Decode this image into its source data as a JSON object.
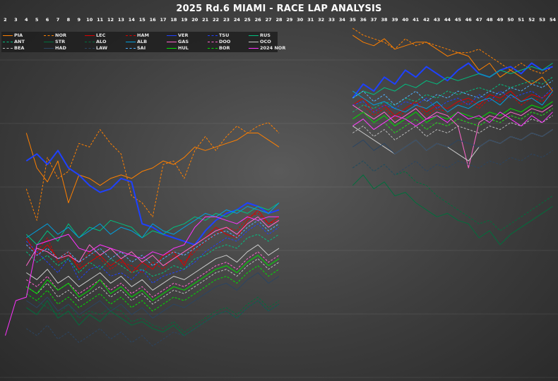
{
  "chart_data": {
    "type": "line",
    "title": "2025 Rd.6 MIAMI - RACE LAP ANALYSIS",
    "x": [
      2,
      3,
      4,
      5,
      6,
      7,
      8,
      9,
      10,
      11,
      12,
      13,
      14,
      15,
      16,
      17,
      18,
      19,
      20,
      21,
      22,
      23,
      24,
      25,
      26,
      27,
      28,
      29,
      30,
      31,
      32,
      33,
      34,
      35,
      36,
      37,
      38,
      39,
      40,
      41,
      42,
      43,
      44,
      45,
      46,
      47,
      48,
      49,
      50,
      51,
      52,
      53,
      54
    ],
    "xlim": [
      1.5,
      54.5
    ],
    "ylim": [
      0,
      100
    ],
    "grid": true,
    "legend_position": "top-left",
    "series": [
      {
        "name": "PIA",
        "color": "#ff8000",
        "dash": "solid",
        "values": [
          null,
          null,
          70,
          60,
          56,
          62,
          50,
          58,
          57,
          55,
          57,
          58,
          57,
          59,
          60,
          62,
          61,
          63,
          66,
          65,
          66,
          67,
          68,
          70,
          70,
          68,
          66,
          null,
          null,
          null,
          null,
          null,
          null,
          98,
          96,
          95,
          97,
          94,
          95,
          96,
          96,
          94,
          92,
          93,
          92,
          88,
          90,
          86,
          88,
          86,
          84,
          86,
          82
        ]
      },
      {
        "name": "NOR",
        "color": "#ff8000",
        "dash": "dashed",
        "values": [
          null,
          null,
          54,
          45,
          63,
          57,
          59,
          67,
          66,
          71,
          67,
          64,
          52,
          50,
          46,
          61,
          62,
          57,
          65,
          69,
          65,
          69,
          72,
          70,
          72,
          73,
          70,
          null,
          null,
          null,
          null,
          null,
          null,
          100,
          98,
          97,
          96,
          94,
          97,
          95,
          96,
          95,
          94,
          93,
          93,
          94,
          92,
          90,
          88,
          90,
          88,
          87,
          89
        ]
      },
      {
        "name": "LEC",
        "color": "#dc0000",
        "dash": "solid",
        "values": [
          null,
          null,
          40,
          35,
          38,
          34,
          36,
          31,
          33,
          35,
          32,
          34,
          30,
          33,
          31,
          35,
          36,
          32,
          38,
          40,
          43,
          41,
          40,
          45,
          48,
          44,
          46,
          null,
          null,
          null,
          null,
          null,
          null,
          78,
          80,
          76,
          78,
          75,
          77,
          79,
          76,
          78,
          77,
          79,
          80,
          78,
          81,
          80,
          82,
          79,
          81,
          80,
          82
        ]
      },
      {
        "name": "HAM",
        "color": "#dc0000",
        "dash": "dashed",
        "values": [
          null,
          null,
          38,
          36,
          40,
          33,
          35,
          32,
          36,
          34,
          31,
          33,
          32,
          30,
          33,
          31,
          35,
          33,
          36,
          39,
          41,
          43,
          42,
          46,
          47,
          44,
          45,
          null,
          null,
          null,
          null,
          null,
          null,
          76,
          78,
          75,
          77,
          74,
          76,
          78,
          75,
          77,
          76,
          78,
          79,
          77,
          80,
          79,
          81,
          78,
          80,
          79,
          81
        ]
      },
      {
        "name": "VER",
        "color": "#1e41ff",
        "dash": "solid",
        "values": [
          null,
          null,
          62,
          64,
          61,
          65,
          60,
          58,
          55,
          53,
          54,
          57,
          56,
          44,
          43,
          41,
          40,
          39,
          38,
          42,
          45,
          47,
          48,
          50,
          49,
          47,
          48,
          null,
          null,
          null,
          null,
          null,
          null,
          80,
          84,
          82,
          86,
          84,
          88,
          86,
          89,
          87,
          85,
          88,
          90,
          87,
          86,
          88,
          89,
          87,
          90,
          88,
          89
        ]
      },
      {
        "name": "TSU",
        "color": "#1e41ff",
        "dash": "dashed",
        "values": [
          null,
          null,
          39,
          36,
          33,
          30,
          34,
          28,
          31,
          32,
          29,
          30,
          28,
          31,
          27,
          29,
          30,
          31,
          33,
          36,
          38,
          40,
          39,
          42,
          44,
          41,
          43,
          null,
          null,
          null,
          null,
          null,
          null,
          78,
          79,
          76,
          78,
          77,
          79,
          78,
          80,
          77,
          79,
          80,
          78,
          81,
          79,
          82,
          80,
          81,
          82,
          80,
          83
        ]
      },
      {
        "name": "RUS",
        "color": "#00c080",
        "dash": "solid",
        "values": [
          null,
          null,
          41,
          38,
          42,
          39,
          44,
          40,
          43,
          42,
          45,
          44,
          43,
          40,
          42,
          41,
          43,
          44,
          46,
          45,
          47,
          46,
          48,
          47,
          49,
          48,
          50,
          null,
          null,
          null,
          null,
          null,
          null,
          80,
          82,
          81,
          83,
          82,
          84,
          83,
          85,
          84,
          86,
          85,
          86,
          87,
          86,
          88,
          87,
          88,
          89,
          88,
          90
        ]
      },
      {
        "name": "ANT",
        "color": "#00c080",
        "dash": "dashed",
        "values": [
          null,
          null,
          36,
          33,
          35,
          32,
          34,
          30,
          33,
          31,
          34,
          32,
          30,
          31,
          29,
          30,
          32,
          31,
          34,
          35,
          37,
          38,
          37,
          40,
          41,
          39,
          41,
          null,
          null,
          null,
          null,
          null,
          null,
          76,
          78,
          77,
          79,
          78,
          80,
          79,
          81,
          80,
          82,
          81,
          82,
          83,
          82,
          84,
          83,
          84,
          85,
          84,
          86
        ]
      },
      {
        "name": "STR",
        "color": "#006f3c",
        "dash": "solid",
        "values": [
          null,
          null,
          20,
          18,
          22,
          17,
          19,
          15,
          18,
          16,
          19,
          17,
          15,
          16,
          14,
          13,
          15,
          12,
          14,
          16,
          18,
          19,
          17,
          20,
          22,
          19,
          21,
          null,
          null,
          null,
          null,
          null,
          null,
          55,
          58,
          54,
          56,
          52,
          53,
          50,
          48,
          46,
          47,
          45,
          44,
          40,
          42,
          38,
          41,
          43,
          45,
          47,
          49
        ]
      },
      {
        "name": "ALO",
        "color": "#006f3c",
        "dash": "dashed",
        "values": [
          null,
          null,
          24,
          22,
          20,
          18,
          21,
          17,
          19,
          18,
          20,
          19,
          16,
          17,
          15,
          14,
          16,
          13,
          15,
          17,
          19,
          20,
          18,
          21,
          23,
          20,
          22,
          null,
          null,
          null,
          null,
          null,
          null,
          60,
          62,
          59,
          61,
          58,
          59,
          56,
          55,
          52,
          50,
          48,
          46,
          44,
          45,
          42,
          44,
          46,
          48,
          50,
          52
        ]
      },
      {
        "name": "ALB",
        "color": "#00a0de",
        "dash": "solid",
        "values": [
          null,
          null,
          40,
          42,
          44,
          41,
          43,
          40,
          42,
          44,
          41,
          43,
          42,
          40,
          44,
          42,
          41,
          43,
          45,
          47,
          46,
          48,
          47,
          49,
          48,
          47,
          50,
          null,
          null,
          null,
          null,
          null,
          null,
          82,
          80,
          78,
          79,
          77,
          76,
          78,
          77,
          79,
          76,
          78,
          77,
          79,
          80,
          78,
          81,
          79,
          80,
          78,
          82
        ]
      },
      {
        "name": "GAS",
        "color": "#ff66cc",
        "dash": "solid",
        "values": [
          null,
          null,
          32,
          37,
          36,
          34,
          35,
          33,
          38,
          35,
          37,
          34,
          36,
          33,
          35,
          32,
          34,
          36,
          38,
          40,
          42,
          43,
          41,
          44,
          46,
          43,
          45,
          null,
          null,
          null,
          null,
          null,
          null,
          78,
          76,
          74,
          76,
          73,
          75,
          77,
          74,
          76,
          75,
          72,
          60,
          73,
          75,
          74,
          76,
          75,
          77,
          76,
          78
        ]
      },
      {
        "name": "DOO",
        "color": "#ff66cc",
        "dash": "dashed",
        "values": [
          null,
          null,
          28,
          26,
          29,
          25,
          27,
          24,
          26,
          28,
          25,
          27,
          24,
          26,
          23,
          25,
          27,
          26,
          28,
          30,
          32,
          33,
          31,
          34,
          36,
          33,
          35,
          null,
          null,
          null,
          null,
          null,
          null,
          72,
          74,
          71,
          73,
          70,
          72,
          74,
          71,
          73,
          72,
          74,
          73,
          72,
          74,
          73,
          75,
          74,
          76,
          75,
          77
        ]
      },
      {
        "name": "SAI",
        "color": "#4fb0ff",
        "dash": "dashed",
        "values": [
          null,
          null,
          38,
          35,
          37,
          34,
          36,
          33,
          35,
          37,
          34,
          36,
          33,
          35,
          32,
          34,
          36,
          35,
          37,
          39,
          41,
          42,
          40,
          43,
          45,
          42,
          44,
          null,
          null,
          null,
          null,
          null,
          null,
          80,
          82,
          79,
          81,
          78,
          80,
          82,
          79,
          81,
          80,
          82,
          81,
          80,
          82,
          81,
          83,
          82,
          84,
          83,
          85
        ]
      },
      {
        "name": "OCO",
        "color": "#cccccc",
        "dash": "solid",
        "values": [
          null,
          null,
          30,
          28,
          31,
          27,
          29,
          26,
          28,
          30,
          27,
          29,
          26,
          28,
          25,
          27,
          29,
          28,
          30,
          32,
          34,
          35,
          33,
          36,
          38,
          35,
          37,
          null,
          null,
          null,
          null,
          null,
          null,
          72,
          70,
          68,
          66,
          64,
          66,
          68,
          65,
          67,
          66,
          64,
          62,
          66,
          68,
          67,
          69,
          68,
          70,
          69,
          71
        ]
      },
      {
        "name": "BEA",
        "color": "#bbbbbb",
        "dash": "dashed",
        "values": [
          null,
          null,
          26,
          24,
          27,
          23,
          25,
          22,
          24,
          26,
          23,
          25,
          22,
          24,
          21,
          23,
          25,
          24,
          26,
          28,
          30,
          31,
          29,
          32,
          34,
          31,
          33,
          null,
          null,
          null,
          null,
          null,
          null,
          70,
          72,
          69,
          71,
          68,
          70,
          72,
          69,
          71,
          70,
          72,
          71,
          70,
          72,
          71,
          73,
          72,
          74,
          73,
          75
        ]
      },
      {
        "name": "HAD",
        "color": "#2b4562",
        "dash": "solid",
        "values": [
          null,
          null,
          22,
          20,
          23,
          19,
          21,
          18,
          20,
          22,
          19,
          21,
          18,
          20,
          17,
          19,
          21,
          20,
          22,
          24,
          26,
          27,
          25,
          28,
          30,
          27,
          29,
          null,
          null,
          null,
          null,
          null,
          null,
          66,
          68,
          65,
          67,
          64,
          66,
          68,
          65,
          67,
          66,
          68,
          67,
          66,
          68,
          67,
          69,
          68,
          70,
          69,
          71
        ]
      },
      {
        "name": "LAW",
        "color": "#2b4562",
        "dash": "dashed",
        "values": [
          null,
          null,
          14,
          12,
          15,
          11,
          13,
          10,
          12,
          14,
          11,
          13,
          10,
          12,
          9,
          11,
          13,
          12,
          14,
          16,
          18,
          19,
          17,
          20,
          22,
          19,
          21,
          null,
          null,
          null,
          null,
          null,
          null,
          60,
          62,
          59,
          61,
          58,
          60,
          62,
          59,
          61,
          60,
          62,
          61,
          60,
          62,
          61,
          63,
          62,
          64,
          63,
          65
        ]
      },
      {
        "name": "HUL",
        "color": "#00e000",
        "dash": "solid",
        "values": [
          null,
          null,
          26,
          24,
          28,
          25,
          27,
          23,
          25,
          28,
          24,
          26,
          23,
          25,
          22,
          24,
          26,
          25,
          27,
          29,
          31,
          32,
          30,
          33,
          35,
          32,
          34,
          null,
          null,
          null,
          null,
          null,
          null,
          74,
          76,
          73,
          75,
          72,
          74,
          76,
          73,
          75,
          74,
          76,
          75,
          74,
          76,
          75,
          77,
          76,
          78,
          77,
          79
        ]
      },
      {
        "name": "BOR",
        "color": "#00e000",
        "dash": "dashed",
        "values": [
          null,
          null,
          24,
          22,
          25,
          21,
          23,
          20,
          22,
          24,
          21,
          23,
          20,
          22,
          19,
          21,
          23,
          22,
          24,
          26,
          28,
          29,
          27,
          30,
          32,
          29,
          31,
          null,
          null,
          null,
          null,
          null,
          null,
          72,
          74,
          71,
          73,
          70,
          72,
          74,
          71,
          73,
          72,
          74,
          73,
          72,
          74,
          73,
          75,
          74,
          76,
          75,
          77
        ]
      },
      {
        "name": "2024 NOR",
        "color": "#ff33ff",
        "dash": "solid",
        "values": [
          12,
          22,
          23,
          38,
          39,
          40,
          41,
          37,
          36,
          38,
          37,
          36,
          35,
          34,
          36,
          35,
          37,
          38,
          43,
          46,
          46,
          45,
          44,
          46,
          45,
          46,
          46,
          null,
          null,
          null,
          null,
          null,
          null,
          72,
          74,
          71,
          73,
          75,
          74,
          72,
          74,
          75,
          73,
          76,
          74,
          75,
          73,
          76,
          74,
          72,
          75,
          73,
          76
        ]
      }
    ],
    "legend_order": [
      "PIA",
      "NOR",
      "LEC",
      "HAM",
      "VER",
      "TSU",
      "RUS",
      "ANT",
      "STR",
      "ALO",
      "ALB",
      "GAS",
      "DOO",
      "OCO",
      "BEA",
      "HAD",
      "LAW",
      "SAI",
      "HUL",
      "BOR",
      "2024 NOR"
    ]
  }
}
